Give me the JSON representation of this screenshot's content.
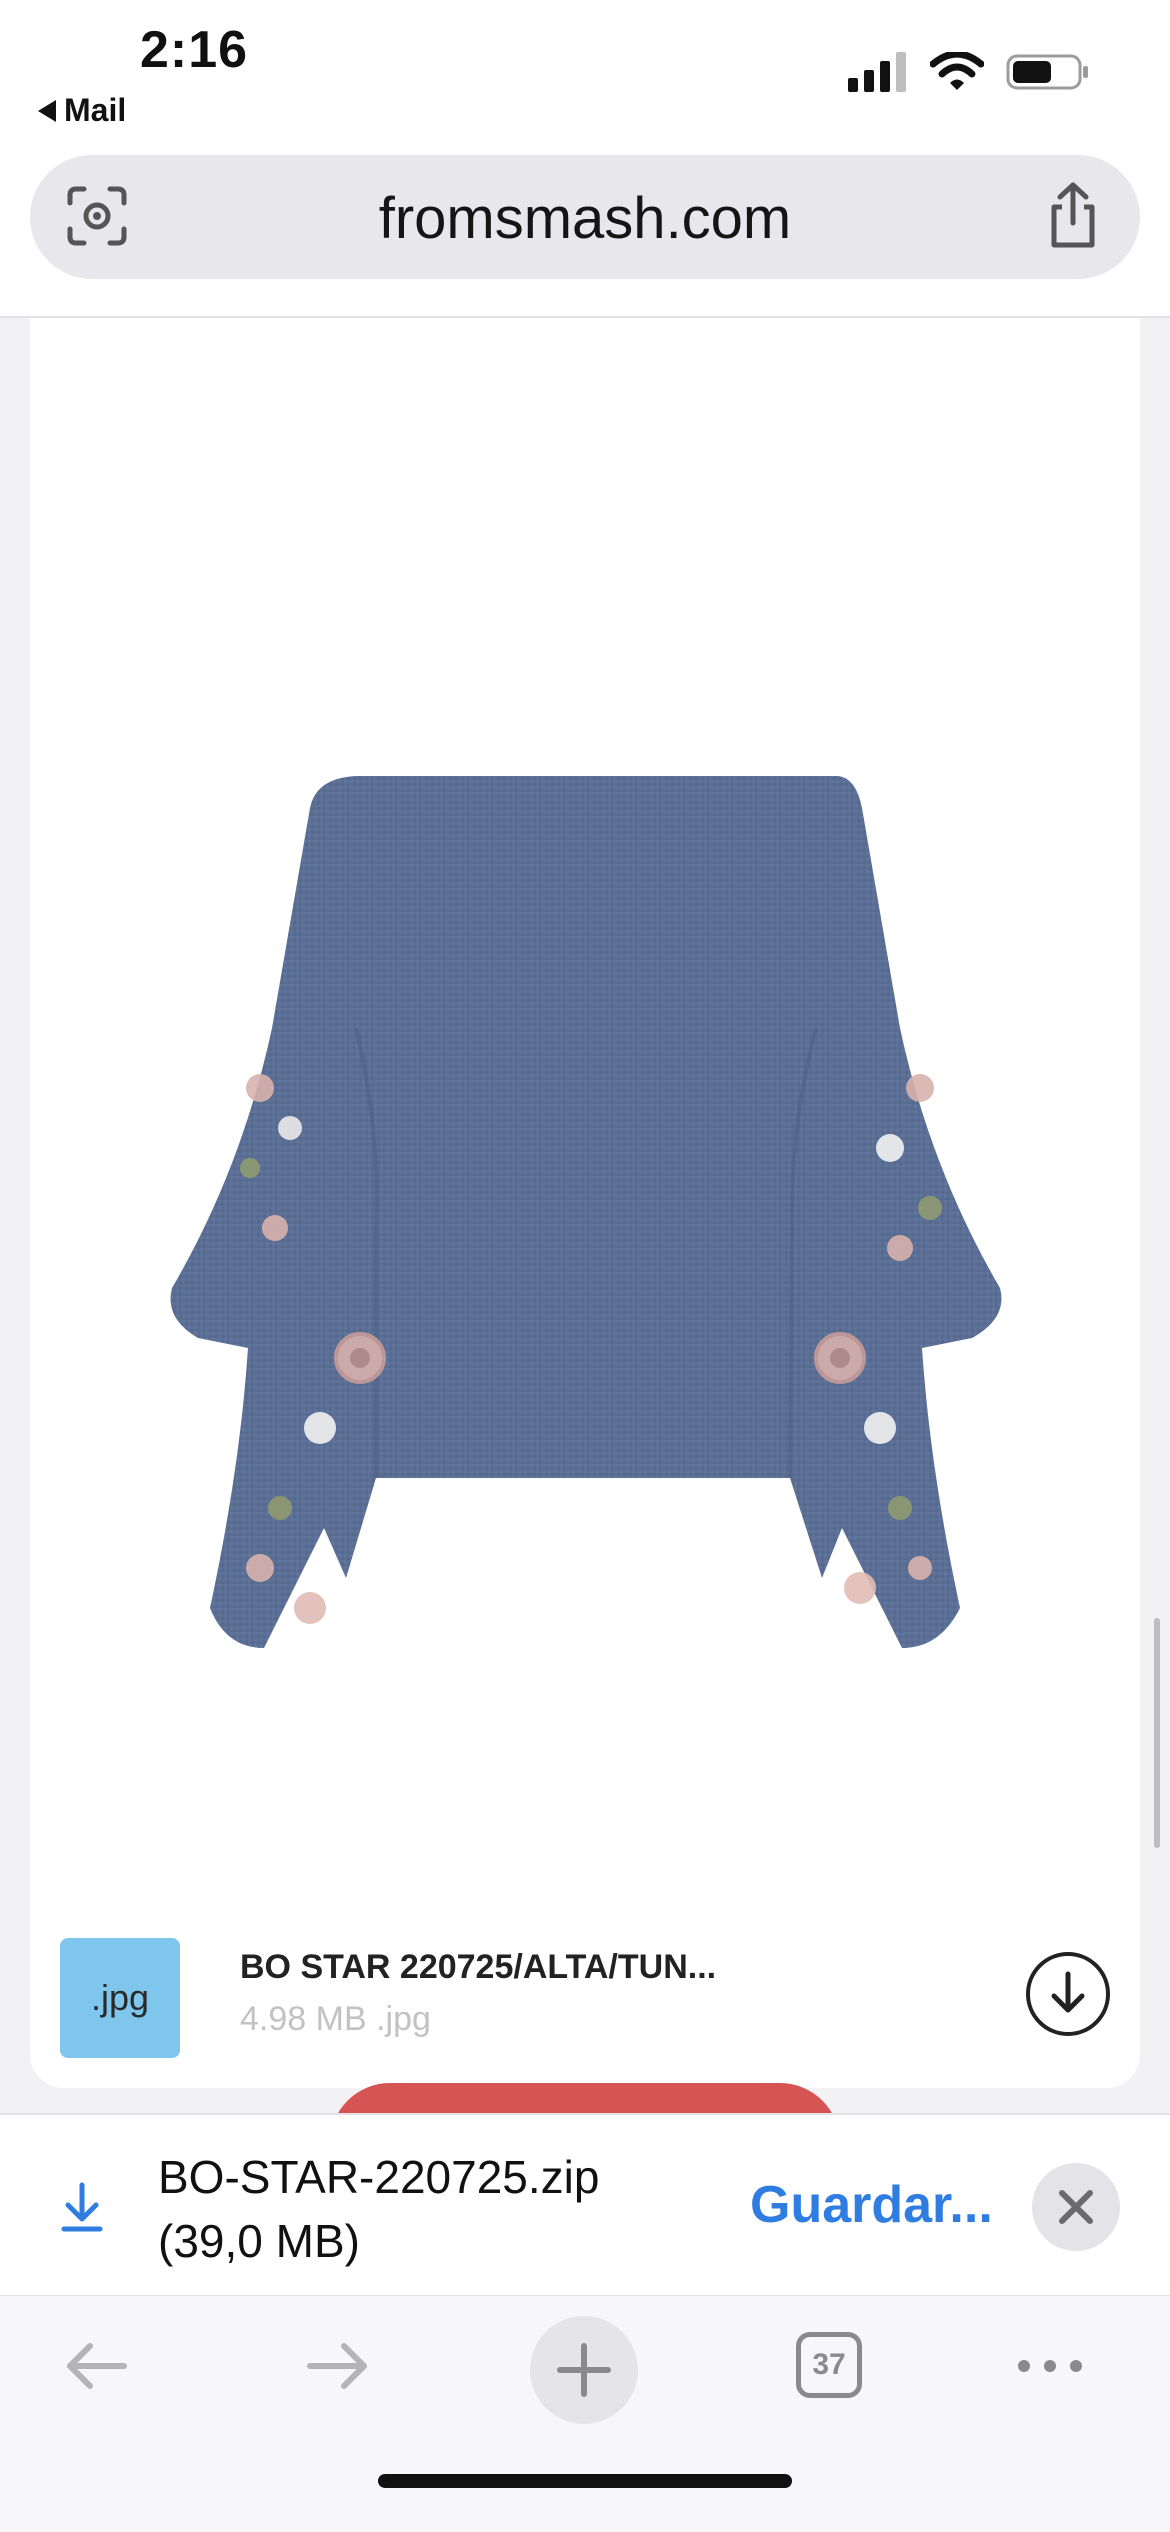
{
  "status_bar": {
    "time": "2:16",
    "back_app": "Mail"
  },
  "url_bar": {
    "url": "fromsmash.com"
  },
  "file_card": {
    "extension_badge": ".jpg",
    "file_name": "BO STAR 220725/ALTA/TUN...",
    "file_meta": "4.98 MB .jpg"
  },
  "download_bar": {
    "file_name": "BO-STAR-220725.zip",
    "file_size": "(39,0 MB)",
    "save_label": "Guardar..."
  },
  "toolbar": {
    "tab_count": "37"
  },
  "colors": {
    "accent": "#2f7de1",
    "badge": "#7fc6ec",
    "action_button": "#d65454",
    "garment": "#5a6f96"
  },
  "icons": {
    "lens": "visual-search-icon",
    "share": "share-icon",
    "download": "download-icon",
    "close": "close-icon",
    "back": "back-arrow-icon",
    "forward": "forward-arrow-icon",
    "new_tab": "plus-icon",
    "tabs": "tabs-icon",
    "more": "more-icon"
  }
}
